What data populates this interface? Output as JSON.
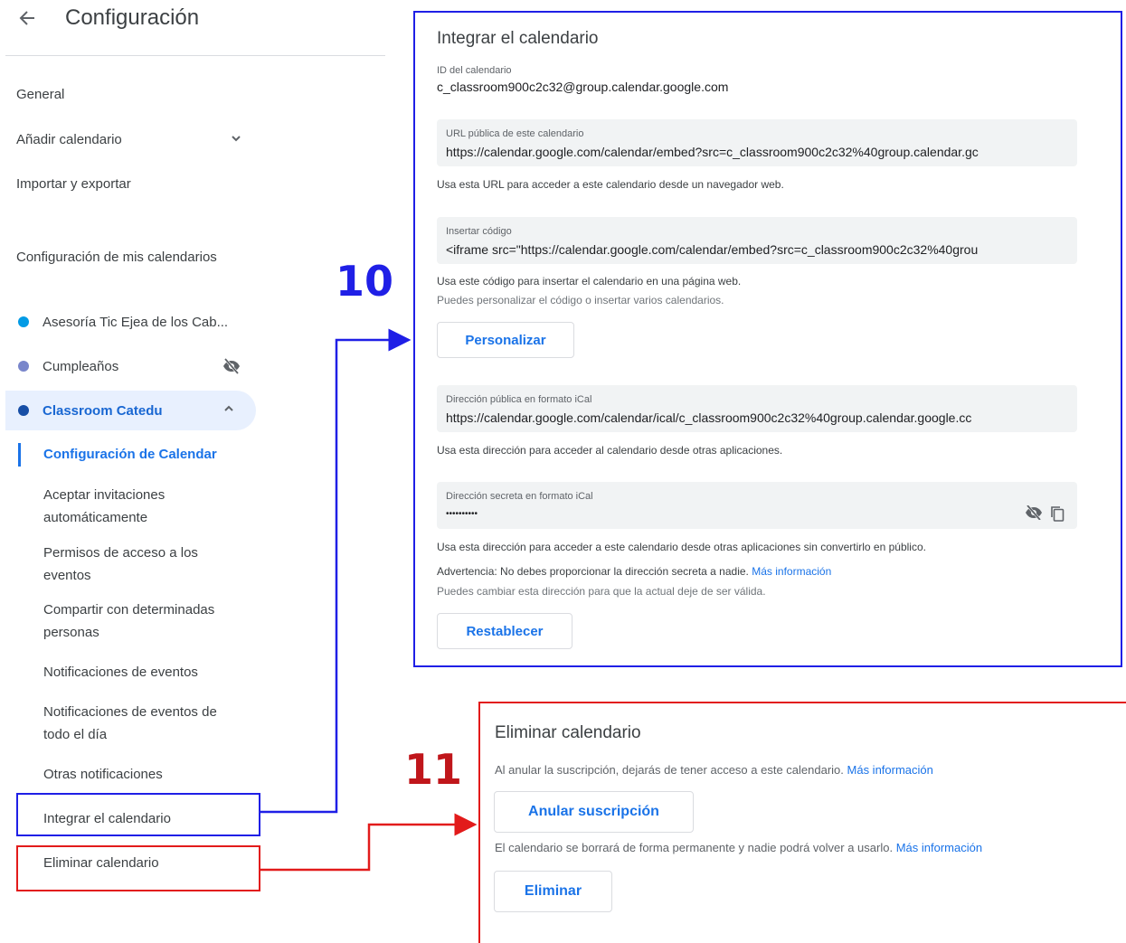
{
  "header": {
    "title": "Configuración"
  },
  "sidebar": {
    "general": "General",
    "add_calendar": "Añadir calendario",
    "import_export": "Importar y exportar",
    "my_calendars_section": "Configuración de mis calendarios",
    "calendars": [
      {
        "name": "Asesoría Tic Ejea de los Cab...",
        "color": "#039be5"
      },
      {
        "name": "Cumpleaños",
        "color": "#7986cb"
      },
      {
        "name": "Classroom Catedu",
        "color": "#174ea6"
      }
    ],
    "sub_items": [
      "Configuración de Calendar",
      "Aceptar invitaciones automáticamente",
      "Permisos de acceso a los eventos",
      "Compartir con determinadas personas",
      "Notificaciones de eventos",
      "Notificaciones de eventos de todo el día",
      "Otras notificaciones",
      "Integrar el calendario",
      "Eliminar calendario"
    ]
  },
  "integrate": {
    "title": "Integrar el calendario",
    "calendar_id_label": "ID del calendario",
    "calendar_id": "c_classroom900c2c32@group.calendar.google.com",
    "public_url_label": "URL pública de este calendario",
    "public_url": "https://calendar.google.com/calendar/embed?src=c_classroom900c2c32%40group.calendar.gc",
    "public_url_hint": "Usa esta URL para acceder a este calendario desde un navegador web.",
    "embed_label": "Insertar código",
    "embed_code": "<iframe src=\"https://calendar.google.com/calendar/embed?src=c_classroom900c2c32%40grou",
    "embed_hint": "Usa este código para insertar el calendario en una página web.",
    "embed_hint2": "Puedes personalizar el código o insertar varios calendarios.",
    "customize_button": "Personalizar",
    "public_ical_label": "Dirección pública en formato iCal",
    "public_ical": "https://calendar.google.com/calendar/ical/c_classroom900c2c32%40group.calendar.google.cc",
    "public_ical_hint": "Usa esta dirección para acceder al calendario desde otras aplicaciones.",
    "secret_ical_label": "Dirección secreta en formato iCal",
    "secret_ical": "••••••••••",
    "secret_hint": "Usa esta dirección para acceder a este calendario desde otras aplicaciones sin convertirlo en público.",
    "warning": "Advertencia: No debes proporcionar la dirección secreta a nadie.",
    "more_info": "Más información",
    "change_hint": "Puedes cambiar esta dirección para que la actual deje de ser válida.",
    "reset_button": "Restablecer"
  },
  "remove": {
    "title": "Eliminar calendario",
    "unsubscribe_text": "Al anular la suscripción, dejarás de tener acceso a este calendario.",
    "more_info": "Más información",
    "unsubscribe_button": "Anular suscripción",
    "delete_text": "El calendario se borrará de forma permanente y nadie podrá volver a usarlo.",
    "delete_button": "Eliminar"
  },
  "annotations": {
    "step_10": "10",
    "step_11": "11",
    "blue": "#1f1fe6",
    "red": "#e21b1b"
  }
}
